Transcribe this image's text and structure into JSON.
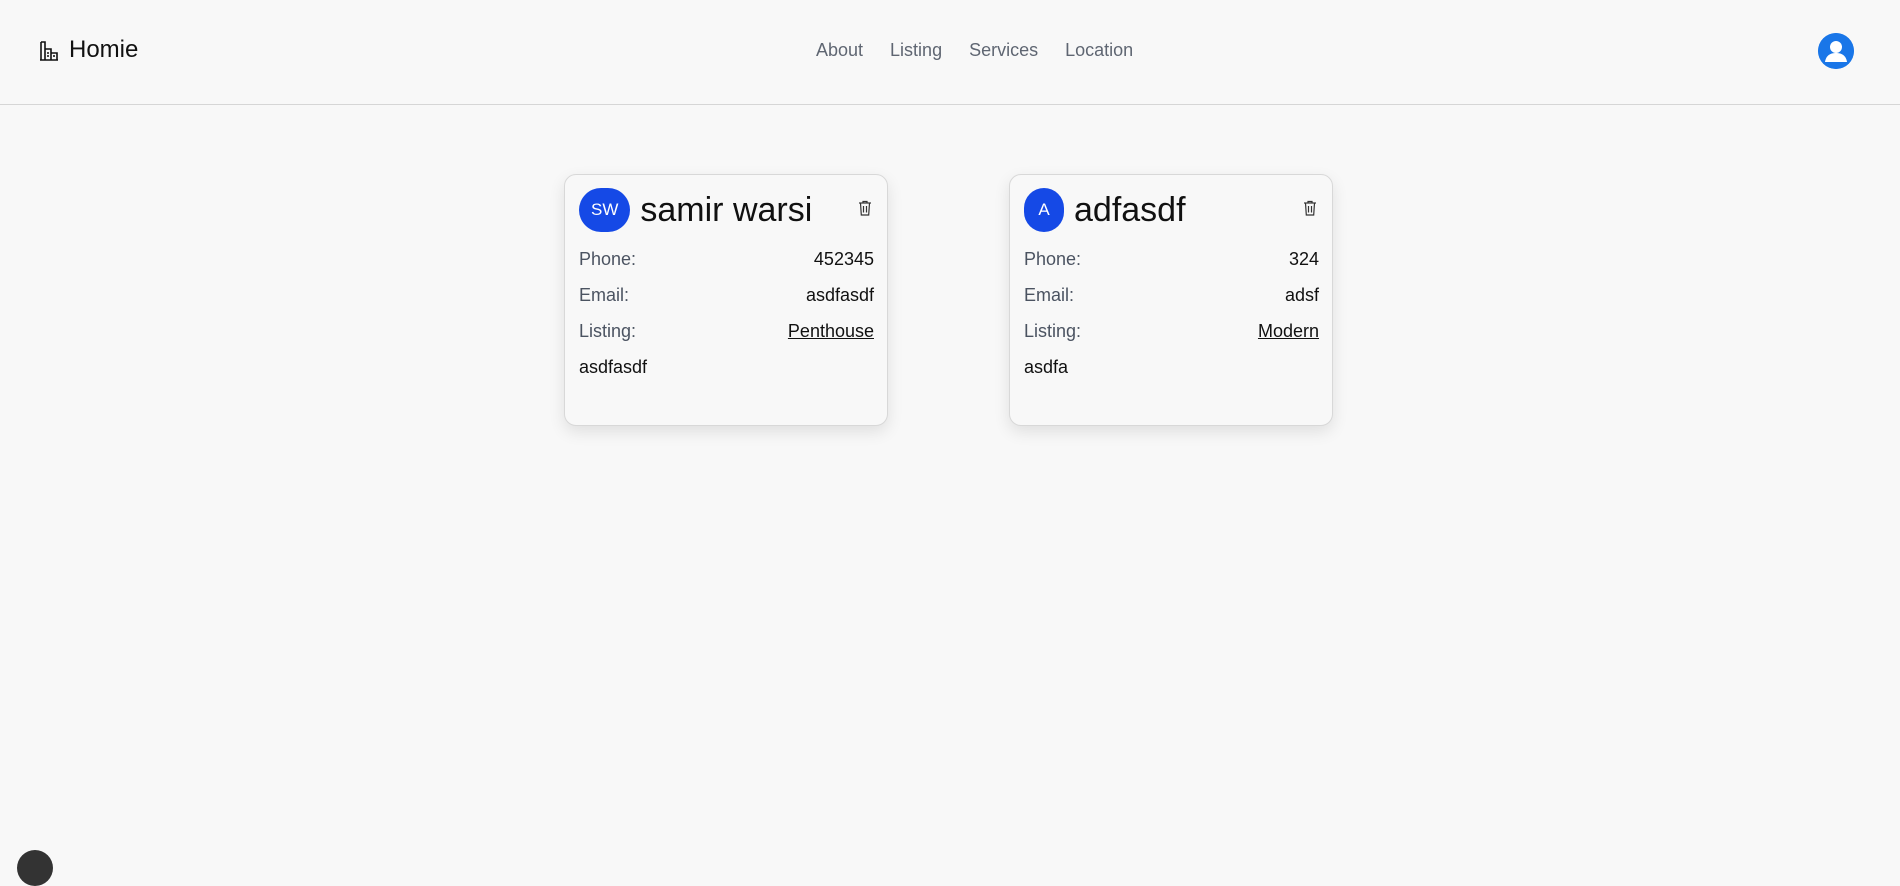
{
  "header": {
    "brand": "Homie",
    "brand_icon": "building-icon",
    "nav": [
      "About",
      "Listing",
      "Services",
      "Location"
    ],
    "user_icon": "user-icon",
    "accent": "#1976e8"
  },
  "cards": [
    {
      "initials": "SW",
      "name": "samir warsi",
      "phone_label": "Phone:",
      "phone": "452345",
      "email_label": "Email:",
      "email": "asdfasdf",
      "listing_label": "Listing:",
      "listing": "Penthouse",
      "message": "asdfasdf",
      "delete_icon": "trash-icon"
    },
    {
      "initials": "A",
      "name": "adfasdf",
      "phone_label": "Phone:",
      "phone": "324",
      "email_label": "Email:",
      "email": "adsf",
      "listing_label": "Listing:",
      "listing": "Modern",
      "message": "asdfa",
      "delete_icon": "trash-icon"
    }
  ],
  "colors": {
    "initials_bg": "#1549e6",
    "background": "#f8f8f8"
  }
}
